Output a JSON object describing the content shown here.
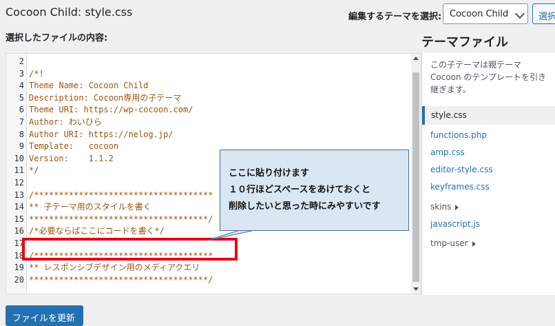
{
  "header": {
    "title": "Cocoon Child: style.css",
    "theme_select_label": "編集するテーマを選択:",
    "theme_select_value": "Cocoon Child",
    "select_button": "選択"
  },
  "editor": {
    "content_label": "選択したファイルの内容:",
    "lines": [
      {
        "n": "2",
        "code": ""
      },
      {
        "n": "3",
        "code": "/*!"
      },
      {
        "n": "4",
        "code": "Theme Name: Cocoon Child"
      },
      {
        "n": "5",
        "code": "Description: Cocoon専用の子テーマ"
      },
      {
        "n": "6",
        "code": "Theme URI: https://wp-cocoon.com/"
      },
      {
        "n": "7",
        "code": "Author: わいひら"
      },
      {
        "n": "8",
        "code": "Author URI: https://nelog.jp/"
      },
      {
        "n": "9",
        "code": "Template:   cocoon"
      },
      {
        "n": "10",
        "code": "Version:    1.1.2"
      },
      {
        "n": "11",
        "code": "*/"
      },
      {
        "n": "12",
        "code": ""
      },
      {
        "n": "13",
        "code": "/************************************"
      },
      {
        "n": "14",
        "code": "** 子テーマ用のスタイルを書く"
      },
      {
        "n": "15",
        "code": "************************************/"
      },
      {
        "n": "16",
        "code": "/*必要ならばここにコードを書く*/"
      },
      {
        "n": "17",
        "code": ""
      },
      {
        "n": "18",
        "code": "/************************************"
      },
      {
        "n": "19",
        "code": "** レスポンシブデザイン用のメディアクエリ"
      },
      {
        "n": "20",
        "code": "************************************/"
      }
    ]
  },
  "callout": {
    "line1": "ここに貼り付けます",
    "line2": "１０行ほどスペースをあけておくと",
    "line3": "削除したいと思った時にみやすいです"
  },
  "sidebar": {
    "title": "テーマファイル",
    "description": "この子テーマは親テーマ Cocoon のテンプレートを引き継ぎます。",
    "files": [
      "style.css",
      "functions.php",
      "amp.css",
      "editor-style.css",
      "keyframes.css"
    ],
    "folders": [
      "skins",
      "javascript.js",
      "tmp-user"
    ]
  },
  "footer": {
    "update_button": "ファイルを更新"
  },
  "colors": {
    "accent": "#2271b1",
    "code_text": "#a0530e",
    "highlight": "#e60012",
    "callout_bg": "#dbe6f3"
  }
}
